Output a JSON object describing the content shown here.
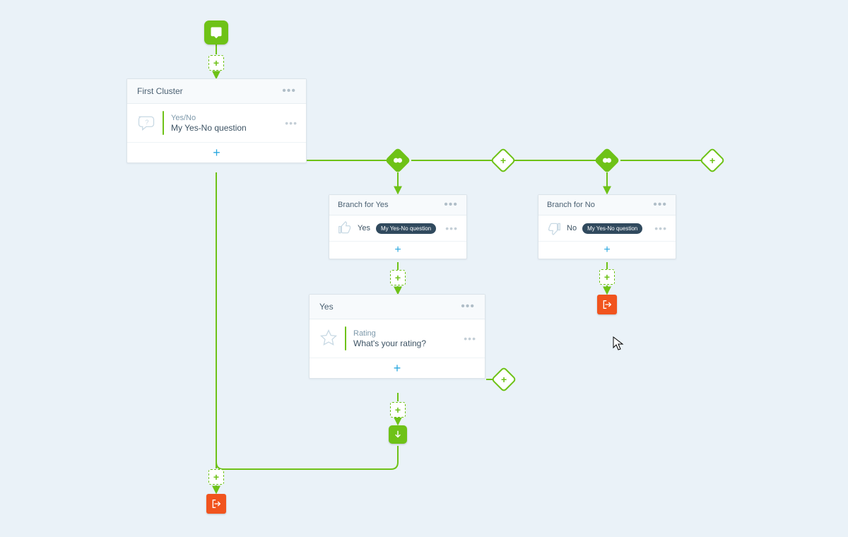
{
  "colors": {
    "green": "#6ec217",
    "orange": "#f1541e",
    "blue": "#29a7df",
    "bg": "#eaf2f8"
  },
  "cluster1": {
    "title": "First Cluster",
    "question": {
      "type": "Yes/No",
      "name": "My Yes-No question"
    }
  },
  "branchYes": {
    "title": "Branch for Yes",
    "label": "Yes",
    "badge": "My Yes-No question"
  },
  "branchNo": {
    "title": "Branch for No",
    "label": "No",
    "badge": "My Yes-No question"
  },
  "clusterYes": {
    "title": "Yes",
    "question": {
      "type": "Rating",
      "name": "What's your rating?"
    }
  }
}
